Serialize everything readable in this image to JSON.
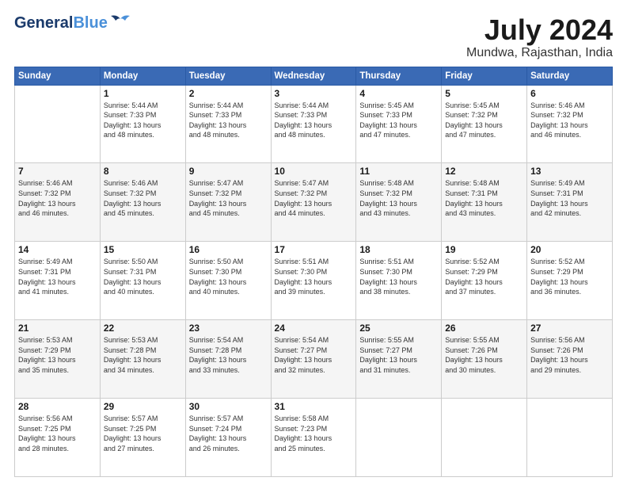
{
  "logo": {
    "line1": "General",
    "line2": "Blue"
  },
  "title": "July 2024",
  "location": "Mundwa, Rajasthan, India",
  "days_of_week": [
    "Sunday",
    "Monday",
    "Tuesday",
    "Wednesday",
    "Thursday",
    "Friday",
    "Saturday"
  ],
  "weeks": [
    [
      {
        "day": "",
        "info": ""
      },
      {
        "day": "1",
        "info": "Sunrise: 5:44 AM\nSunset: 7:33 PM\nDaylight: 13 hours\nand 48 minutes."
      },
      {
        "day": "2",
        "info": "Sunrise: 5:44 AM\nSunset: 7:33 PM\nDaylight: 13 hours\nand 48 minutes."
      },
      {
        "day": "3",
        "info": "Sunrise: 5:44 AM\nSunset: 7:33 PM\nDaylight: 13 hours\nand 48 minutes."
      },
      {
        "day": "4",
        "info": "Sunrise: 5:45 AM\nSunset: 7:33 PM\nDaylight: 13 hours\nand 47 minutes."
      },
      {
        "day": "5",
        "info": "Sunrise: 5:45 AM\nSunset: 7:32 PM\nDaylight: 13 hours\nand 47 minutes."
      },
      {
        "day": "6",
        "info": "Sunrise: 5:46 AM\nSunset: 7:32 PM\nDaylight: 13 hours\nand 46 minutes."
      }
    ],
    [
      {
        "day": "7",
        "info": "Sunrise: 5:46 AM\nSunset: 7:32 PM\nDaylight: 13 hours\nand 46 minutes."
      },
      {
        "day": "8",
        "info": "Sunrise: 5:46 AM\nSunset: 7:32 PM\nDaylight: 13 hours\nand 45 minutes."
      },
      {
        "day": "9",
        "info": "Sunrise: 5:47 AM\nSunset: 7:32 PM\nDaylight: 13 hours\nand 45 minutes."
      },
      {
        "day": "10",
        "info": "Sunrise: 5:47 AM\nSunset: 7:32 PM\nDaylight: 13 hours\nand 44 minutes."
      },
      {
        "day": "11",
        "info": "Sunrise: 5:48 AM\nSunset: 7:32 PM\nDaylight: 13 hours\nand 43 minutes."
      },
      {
        "day": "12",
        "info": "Sunrise: 5:48 AM\nSunset: 7:31 PM\nDaylight: 13 hours\nand 43 minutes."
      },
      {
        "day": "13",
        "info": "Sunrise: 5:49 AM\nSunset: 7:31 PM\nDaylight: 13 hours\nand 42 minutes."
      }
    ],
    [
      {
        "day": "14",
        "info": "Sunrise: 5:49 AM\nSunset: 7:31 PM\nDaylight: 13 hours\nand 41 minutes."
      },
      {
        "day": "15",
        "info": "Sunrise: 5:50 AM\nSunset: 7:31 PM\nDaylight: 13 hours\nand 40 minutes."
      },
      {
        "day": "16",
        "info": "Sunrise: 5:50 AM\nSunset: 7:30 PM\nDaylight: 13 hours\nand 40 minutes."
      },
      {
        "day": "17",
        "info": "Sunrise: 5:51 AM\nSunset: 7:30 PM\nDaylight: 13 hours\nand 39 minutes."
      },
      {
        "day": "18",
        "info": "Sunrise: 5:51 AM\nSunset: 7:30 PM\nDaylight: 13 hours\nand 38 minutes."
      },
      {
        "day": "19",
        "info": "Sunrise: 5:52 AM\nSunset: 7:29 PM\nDaylight: 13 hours\nand 37 minutes."
      },
      {
        "day": "20",
        "info": "Sunrise: 5:52 AM\nSunset: 7:29 PM\nDaylight: 13 hours\nand 36 minutes."
      }
    ],
    [
      {
        "day": "21",
        "info": "Sunrise: 5:53 AM\nSunset: 7:29 PM\nDaylight: 13 hours\nand 35 minutes."
      },
      {
        "day": "22",
        "info": "Sunrise: 5:53 AM\nSunset: 7:28 PM\nDaylight: 13 hours\nand 34 minutes."
      },
      {
        "day": "23",
        "info": "Sunrise: 5:54 AM\nSunset: 7:28 PM\nDaylight: 13 hours\nand 33 minutes."
      },
      {
        "day": "24",
        "info": "Sunrise: 5:54 AM\nSunset: 7:27 PM\nDaylight: 13 hours\nand 32 minutes."
      },
      {
        "day": "25",
        "info": "Sunrise: 5:55 AM\nSunset: 7:27 PM\nDaylight: 13 hours\nand 31 minutes."
      },
      {
        "day": "26",
        "info": "Sunrise: 5:55 AM\nSunset: 7:26 PM\nDaylight: 13 hours\nand 30 minutes."
      },
      {
        "day": "27",
        "info": "Sunrise: 5:56 AM\nSunset: 7:26 PM\nDaylight: 13 hours\nand 29 minutes."
      }
    ],
    [
      {
        "day": "28",
        "info": "Sunrise: 5:56 AM\nSunset: 7:25 PM\nDaylight: 13 hours\nand 28 minutes."
      },
      {
        "day": "29",
        "info": "Sunrise: 5:57 AM\nSunset: 7:25 PM\nDaylight: 13 hours\nand 27 minutes."
      },
      {
        "day": "30",
        "info": "Sunrise: 5:57 AM\nSunset: 7:24 PM\nDaylight: 13 hours\nand 26 minutes."
      },
      {
        "day": "31",
        "info": "Sunrise: 5:58 AM\nSunset: 7:23 PM\nDaylight: 13 hours\nand 25 minutes."
      },
      {
        "day": "",
        "info": ""
      },
      {
        "day": "",
        "info": ""
      },
      {
        "day": "",
        "info": ""
      }
    ]
  ]
}
